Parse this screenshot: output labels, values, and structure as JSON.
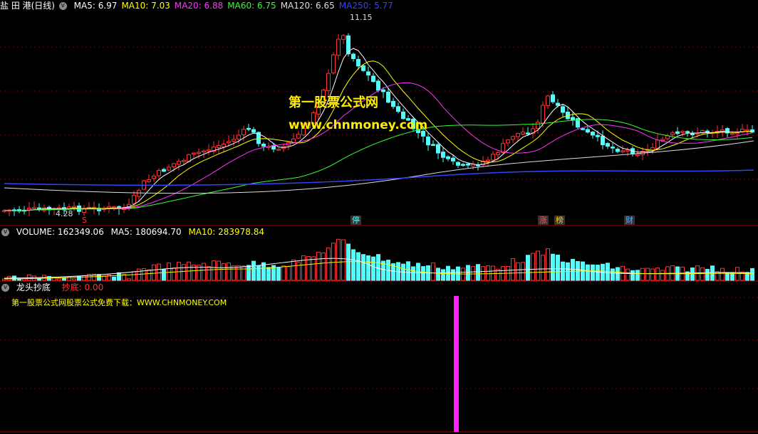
{
  "main": {
    "title": "盐 田 港(日线)",
    "ma": [
      {
        "label": "MA5: 6.97",
        "color": "#ffffff"
      },
      {
        "label": "MA10: 7.03",
        "color": "#ffff00"
      },
      {
        "label": "MA20: 6.88",
        "color": "#ff33ff"
      },
      {
        "label": "MA60: 6.75",
        "color": "#33ff33"
      },
      {
        "label": "MA120: 6.65",
        "color": "#dddddd"
      },
      {
        "label": "MA250: 5.77",
        "color": "#3344ff"
      }
    ],
    "high_label": "11.15",
    "low_label": "4.28",
    "watermark_title": "第一股票公式网",
    "watermark_url": "www.chnmoney.com",
    "tags": [
      "S",
      "停",
      "涨",
      "榜",
      "财"
    ]
  },
  "volume": {
    "label": "VOLUME: 162349.06",
    "ma5": "MA5: 180694.70",
    "ma10": "MA10: 283978.84"
  },
  "indicator": {
    "name": "龙头抄底",
    "value": "抄底: 0.00",
    "note": "第一股票公式网股票公式免费下载：WWW.CHNMONEY.COM"
  },
  "colors": {
    "up": "#ff3333",
    "down": "#54fcfc",
    "border": "#aa0000",
    "signal": "#ff22ff"
  }
}
